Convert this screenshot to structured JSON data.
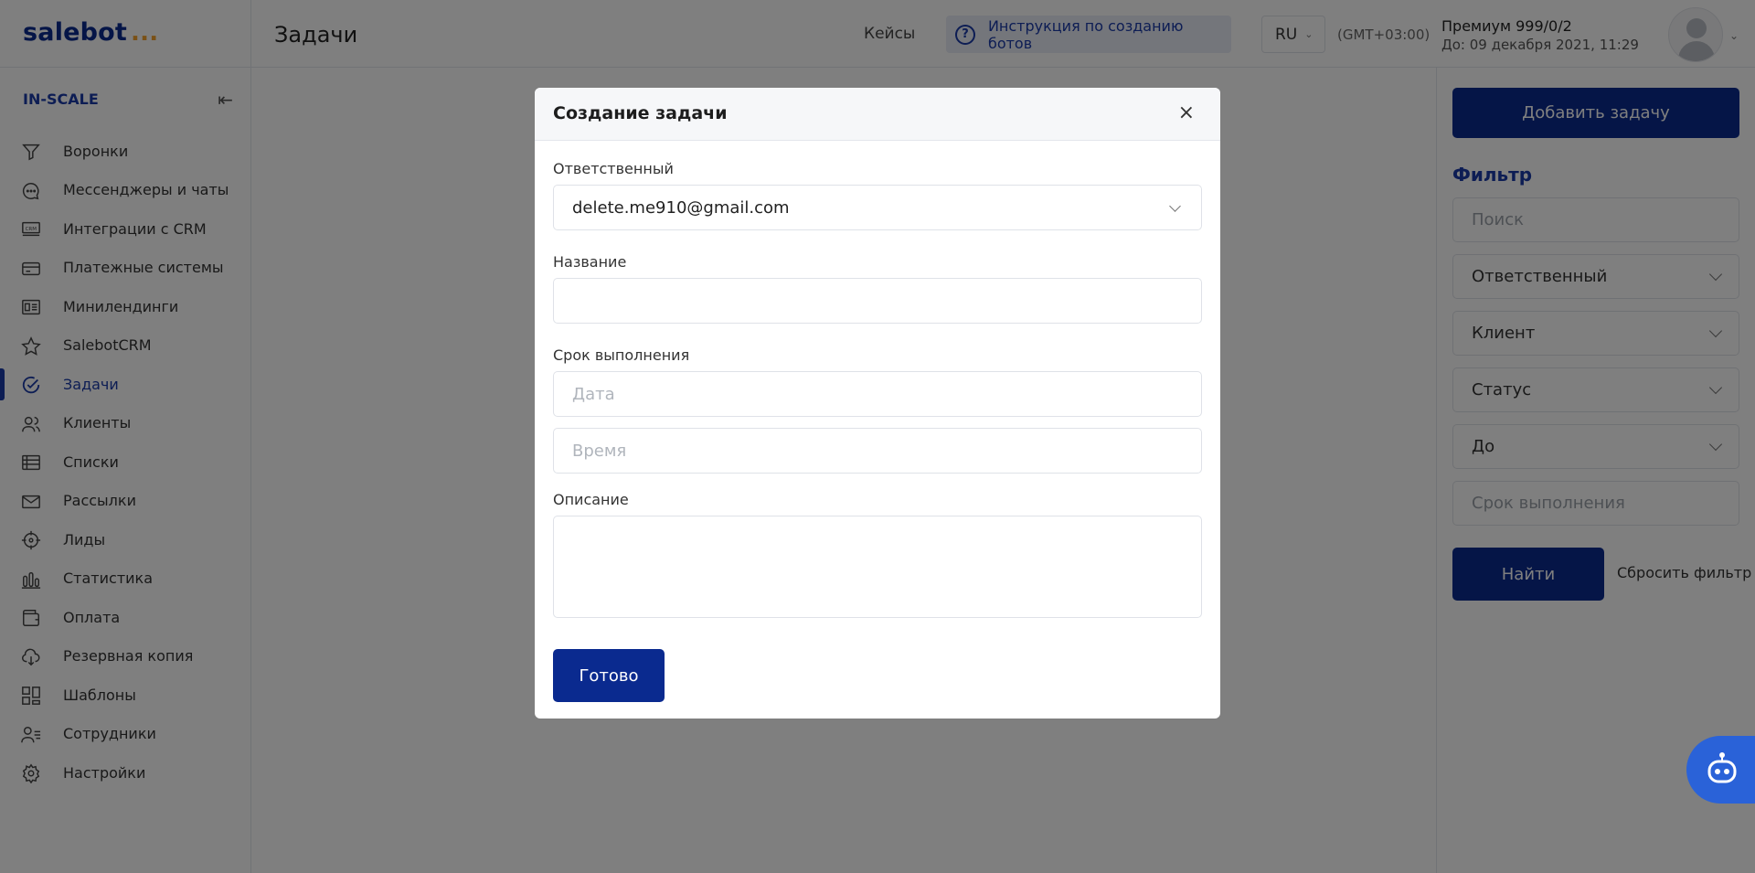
{
  "header": {
    "logo_text": "salebot",
    "logo_dots": "...",
    "page_title": "Задачи",
    "cases_link": "Кейсы",
    "guide_button": "Инструкция по созданию ботов",
    "language": "RU",
    "timezone": "(GMT+03:00)",
    "plan_name": "Премиум 999/0/2",
    "plan_until": "До: 09 декабря 2021, 11:29"
  },
  "sidebar": {
    "brand": "IN-SCALE",
    "items": [
      {
        "label": "Воронки",
        "icon": "funnel-icon"
      },
      {
        "label": "Мессенджеры и чаты",
        "icon": "chat-icon"
      },
      {
        "label": "Интеграции с CRM",
        "icon": "crm-icon"
      },
      {
        "label": "Платежные системы",
        "icon": "card-icon"
      },
      {
        "label": "Минилендинги",
        "icon": "landing-icon"
      },
      {
        "label": "SalebotCRM",
        "icon": "star-icon"
      },
      {
        "label": "Задачи",
        "icon": "check-circle-icon",
        "active": true
      },
      {
        "label": "Клиенты",
        "icon": "users-icon"
      },
      {
        "label": "Списки",
        "icon": "list-icon"
      },
      {
        "label": "Рассылки",
        "icon": "mail-icon"
      },
      {
        "label": "Лиды",
        "icon": "target-icon"
      },
      {
        "label": "Статистика",
        "icon": "stats-icon"
      },
      {
        "label": "Оплата",
        "icon": "wallet-icon"
      },
      {
        "label": "Резервная копия",
        "icon": "cloud-download-icon"
      },
      {
        "label": "Шаблоны",
        "icon": "templates-icon"
      },
      {
        "label": "Сотрудники",
        "icon": "staff-icon"
      },
      {
        "label": "Настройки",
        "icon": "gear-icon"
      }
    ]
  },
  "filter": {
    "add_task": "Добавить задачу",
    "title": "Фильтр",
    "search_placeholder": "Поиск",
    "responsible": "Ответственный",
    "client": "Клиент",
    "status": "Статус",
    "until": "До",
    "deadline_placeholder": "Срок выполнения",
    "find": "Найти",
    "reset": "Сбросить фильтр"
  },
  "modal": {
    "title": "Создание задачи",
    "close": "×",
    "responsible_label": "Ответственный",
    "responsible_value": "delete.me910@gmail.com",
    "name_label": "Название",
    "name_value": "",
    "deadline_label": "Срок выполнения",
    "date_placeholder": "Дата",
    "time_placeholder": "Время",
    "description_label": "Описание",
    "done": "Готово"
  },
  "colors": {
    "brand_blue": "#0a2a8f",
    "accent_blue": "#1a3aa8",
    "logo_dots": "#f4a22e",
    "bot_widget": "#2a62d8"
  }
}
